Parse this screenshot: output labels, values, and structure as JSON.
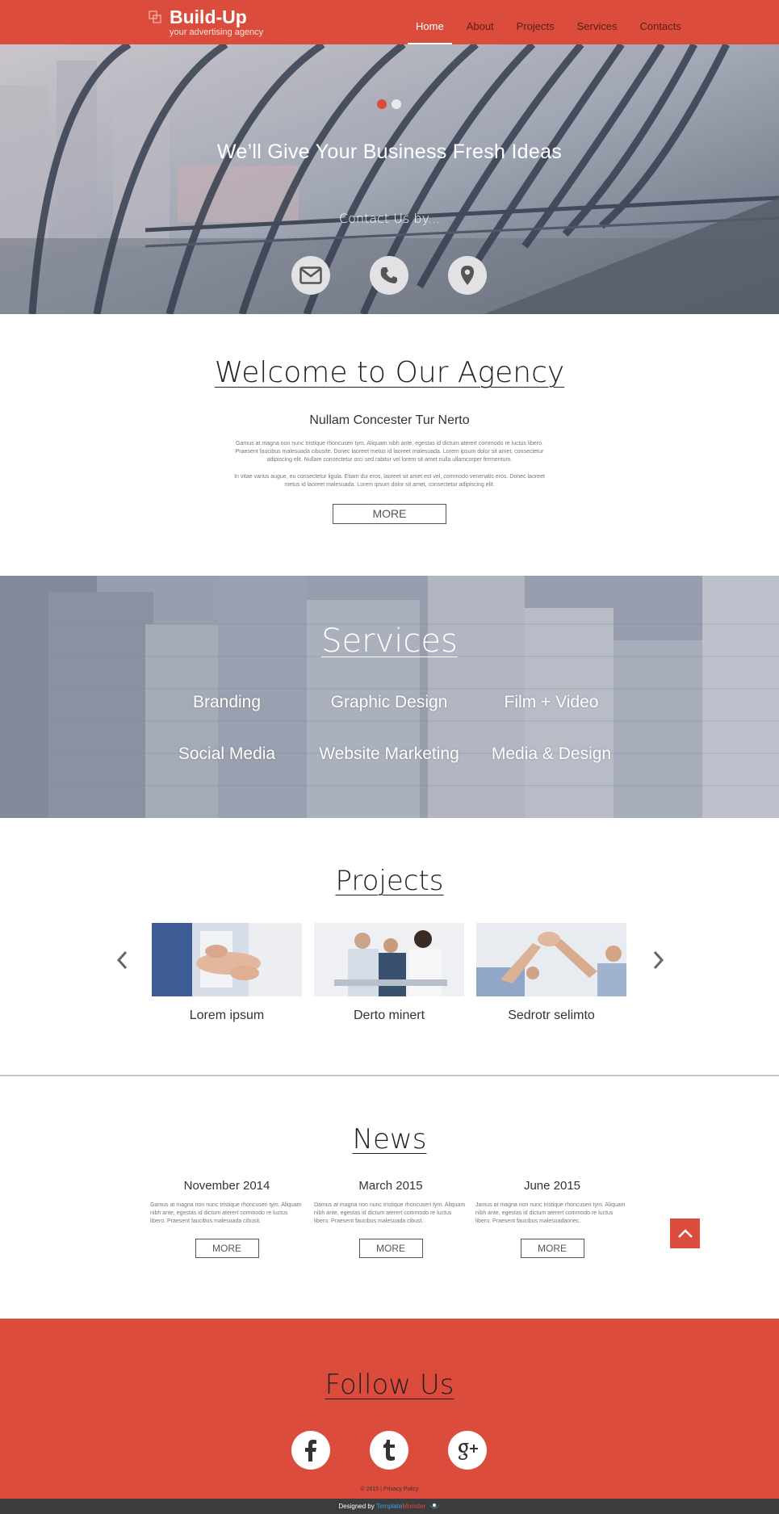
{
  "colors": {
    "accent": "#dc4c3c",
    "footer_bar": "#3d3b3d"
  },
  "header": {
    "logo_icon": "layered-squares-icon",
    "brand": "Build-Up",
    "tagline": "your advertising agency",
    "nav": [
      {
        "label": "Home",
        "active": true
      },
      {
        "label": "About"
      },
      {
        "label": "Projects"
      },
      {
        "label": "Services"
      },
      {
        "label": "Contacts"
      }
    ]
  },
  "hero": {
    "slider_dots": 2,
    "active_dot": 1,
    "title": "We’ll Give Your Business Fresh Ideas",
    "contact_label": "Contact Us by...",
    "contact_icons": [
      "envelope-icon",
      "phone-icon",
      "map-pin-icon"
    ]
  },
  "welcome": {
    "title": "Welcome to Our Agency",
    "subtitle": "Nullam Concester Tur Nerto",
    "paragraph1": "Gamus at magna non nunc tristique rhoncuseri tym. Aliquam nibh ante, egestas id dictum aterert commodo re luctus libero. Praesent faucibus malesuada cibusite. Donec laoreet metus id laoreet malesuada. Lorem ipsum dolor sit amet, consectetur adipiscing elit. Nullam consectetur orci sed rabitur vel lorem sit amet nulla ullamcorper fermentum.",
    "paragraph2": "In vitae varius augue, eu consectetur ligula. Etiam dui eros, laoreet sit amet est vel, commodo venenatis eros. Donec laoreet metus id laoreet malesuada. Lorem ipsum dolor sit amet, consectetur adipiscing elit.",
    "more": "MORE"
  },
  "services": {
    "title": "Services",
    "items": [
      "Branding",
      "Graphic Design",
      "Film + Video",
      "Social Media",
      "Website Marketing",
      "Media & Design"
    ]
  },
  "projects": {
    "title": "Projects",
    "items": [
      {
        "caption": "Lorem ipsum"
      },
      {
        "caption": "Derto minert"
      },
      {
        "caption": "Sedrotr selimto"
      }
    ]
  },
  "news": {
    "title": "News",
    "items": [
      {
        "date": "November 2014",
        "text": "Gamus at magna non nunc tristique rhoncuseri tym. Aliquam nibh ante, egestas id dictum aterert commodo re luctus libero. Praesent faucibus malesuada cibusit.",
        "more": "MORE"
      },
      {
        "date": "March 2015",
        "text": "Damus at magna non nunc tristique rhoncuseri tym. Aliquam nibh ante, egestas id dictum aterert commodo re luctus libero. Praesent faucibus malesuada cibust.",
        "more": "MORE"
      },
      {
        "date": "June 2015",
        "text": "Jamus at magna non nunc tristique rhoncuseri tym. Aliquam nibh ante, egestas id dictum aterert commodo re luctus libero. Praesent faucibus malesuadaonec.",
        "more": "MORE"
      }
    ]
  },
  "follow": {
    "title": "Follow Us",
    "icons": [
      "facebook-icon",
      "tumblr-icon",
      "google-plus-icon"
    ],
    "copyright": "© 2015 |",
    "privacy": "Privacy Policy"
  },
  "footer": {
    "designed_by": "Designed by",
    "brand_part1": "Template",
    "brand_part2": "Monster"
  }
}
